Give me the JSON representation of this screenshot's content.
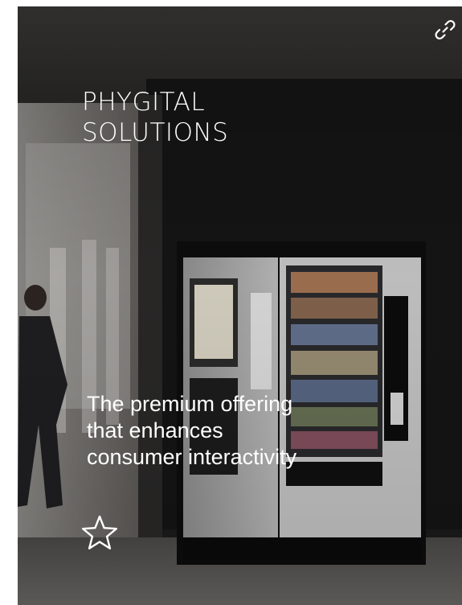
{
  "card": {
    "title_line1": "PHYGITAL",
    "title_line2": "SOLUTIONS",
    "tagline_line1": "The premium offering",
    "tagline_line2": "that enhances",
    "tagline_line3": "consumer interactivity",
    "link_icon": "link-icon",
    "favorite_icon": "star-outline-icon"
  },
  "colors": {
    "text": "#ffffff",
    "background": "#1b1b1b"
  }
}
